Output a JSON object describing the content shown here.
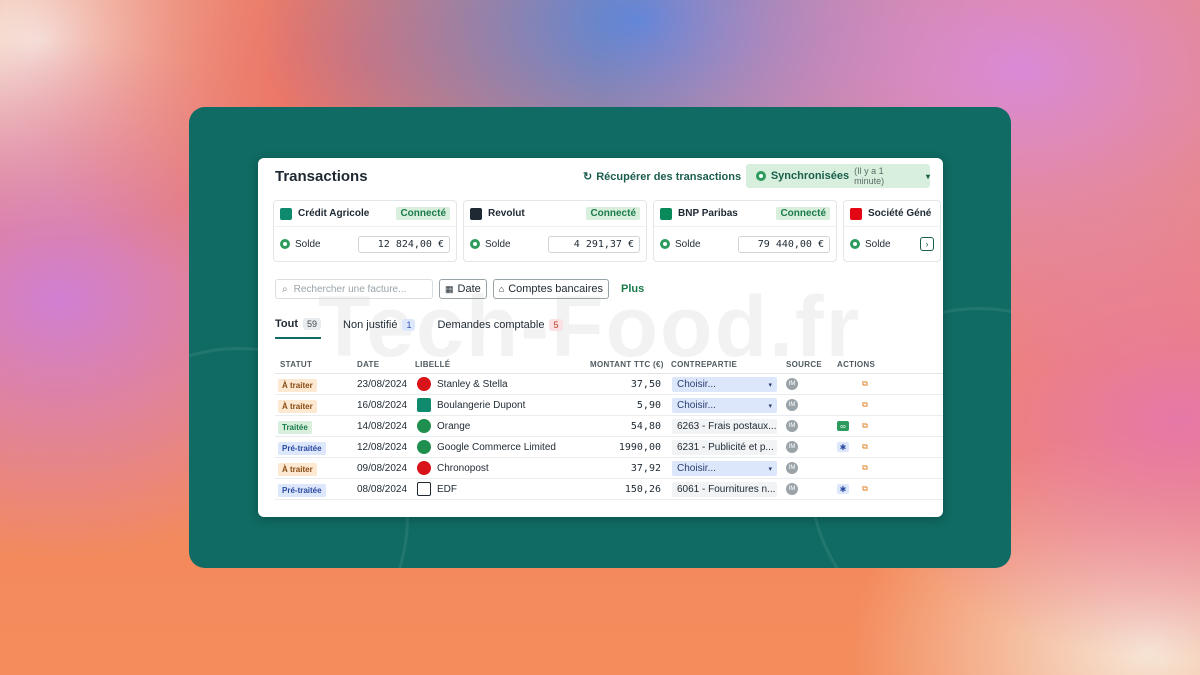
{
  "header": {
    "title": "Transactions",
    "fetch_label": "Récupérer des transactions",
    "sync_label": "Synchronisées",
    "sync_sub": "(Il y a 1 minute)"
  },
  "banks": [
    {
      "name": "Crédit Agricole",
      "status": "Connecté",
      "balance_label": "Solde",
      "balance": "12 824,00 €",
      "color": "#0f8a6e"
    },
    {
      "name": "Revolut",
      "status": "Connecté",
      "balance_label": "Solde",
      "balance": "4 291,37 €",
      "color": "#1f2933"
    },
    {
      "name": "BNP Paribas",
      "status": "Connecté",
      "balance_label": "Solde",
      "balance": "79 440,00 €",
      "color": "#0a8a5a"
    },
    {
      "name": "Société Géné",
      "status": "",
      "balance_label": "Solde",
      "balance": "",
      "color": "#e30613"
    }
  ],
  "toolbar": {
    "search_placeholder": "Rechercher une facture...",
    "date_label": "Date",
    "accounts_label": "Comptes bancaires",
    "more_label": "Plus"
  },
  "tabs": [
    {
      "label": "Tout",
      "count": "59"
    },
    {
      "label": "Non justifié",
      "count": "1"
    },
    {
      "label": "Demandes comptable",
      "count": "5"
    }
  ],
  "columns": {
    "status": "STATUT",
    "date": "DATE",
    "label": "LIBELLÉ",
    "amount": "MONTANT TTC (€)",
    "counterpart": "CONTREPARTIE",
    "source": "SOURCE",
    "actions": "ACTIONS"
  },
  "rows": [
    {
      "status": "À traiter",
      "date": "23/08/2024",
      "label": "Stanley & Stella",
      "amount": "37,50",
      "counterpart": "Choisir...",
      "source": "IM"
    },
    {
      "status": "À traiter",
      "date": "16/08/2024",
      "label": "Boulangerie Dupont",
      "amount": "5,90",
      "counterpart": "Choisir...",
      "source": "IM"
    },
    {
      "status": "Traitée",
      "date": "14/08/2024",
      "label": "Orange",
      "amount": "54,80",
      "counterpart": "6263 - Frais postaux...",
      "source": "IM"
    },
    {
      "status": "Pré-traitée",
      "date": "12/08/2024",
      "label": "Google Commerce Limited",
      "amount": "1990,00",
      "counterpart": "6231 - Publicité et p...",
      "source": "IM"
    },
    {
      "status": "À traiter",
      "date": "09/08/2024",
      "label": "Chronopost",
      "amount": "37,92",
      "counterpart": "Choisir...",
      "source": "IM"
    },
    {
      "status": "Pré-traitée",
      "date": "08/08/2024",
      "label": "EDF",
      "amount": "150,26",
      "counterpart": "6061 - Fournitures n...",
      "source": "IM"
    }
  ],
  "watermark": "Tech-Food.fr"
}
